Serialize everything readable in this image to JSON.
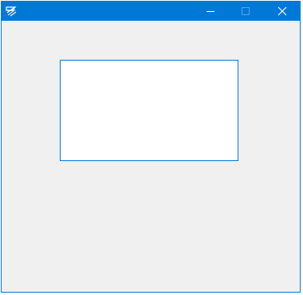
{
  "window": {
    "title": "",
    "accent_color": "#0078d7",
    "background_color": "#f0f0f0"
  },
  "titlebar": {
    "app_icon": "app-logo-icon",
    "buttons": {
      "minimize_icon": "minimize-icon",
      "maximize_icon": "maximize-icon",
      "close_icon": "close-icon",
      "maximize_enabled": false
    }
  },
  "content": {
    "panel_background": "#ffffff",
    "panel_border": "#0078d7"
  }
}
